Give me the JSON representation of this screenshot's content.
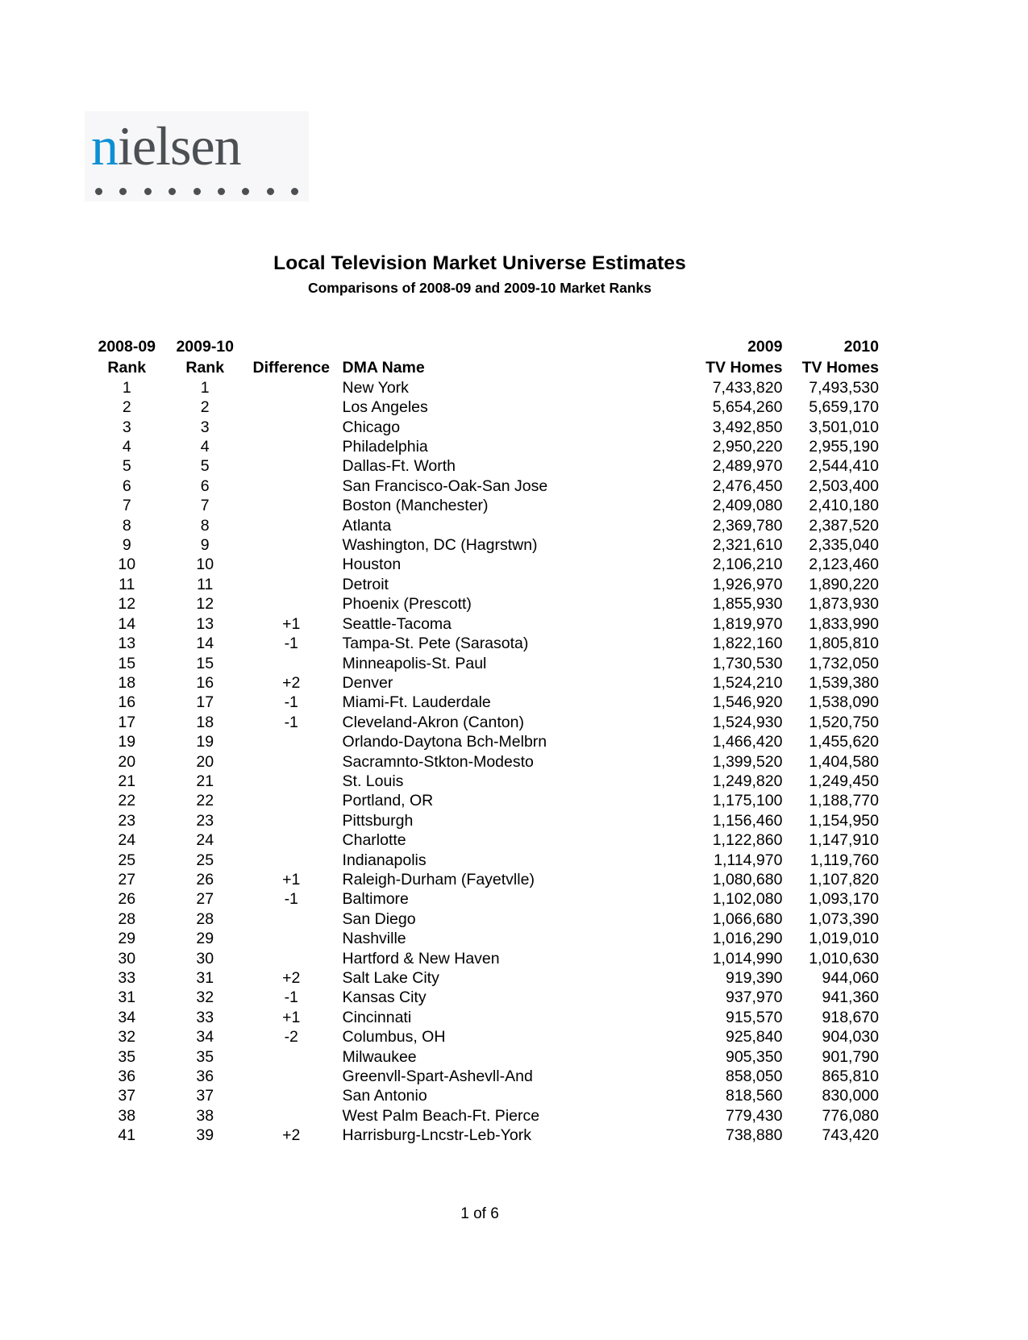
{
  "logo": {
    "first_letter": "n",
    "rest": "ielsen",
    "accent_color": "#0d8fd4",
    "text_color": "#4c4f53",
    "dot_count": 9
  },
  "document": {
    "title": "Local Television Market Universe Estimates",
    "subtitle": "Comparisons of 2008-09 and 2009-10 Market Ranks",
    "footer": "1 of 6"
  },
  "table": {
    "headers_top": {
      "rank_2008_09": "2008-09",
      "rank_2009_10": "2009-10",
      "difference": "",
      "dma_name": "",
      "tv_homes_2009": "2009",
      "tv_homes_2010": "2010"
    },
    "headers_bottom": {
      "rank_2008_09": "Rank",
      "rank_2009_10": "Rank",
      "difference": "Difference",
      "dma_name": "DMA Name",
      "tv_homes_2009": "TV Homes",
      "tv_homes_2010": "TV Homes"
    },
    "rows": [
      {
        "rank_2008_09": "1",
        "rank_2009_10": "1",
        "difference": "",
        "dma_name": "New York",
        "tv_homes_2009": "7,433,820",
        "tv_homes_2010": "7,493,530"
      },
      {
        "rank_2008_09": "2",
        "rank_2009_10": "2",
        "difference": "",
        "dma_name": "Los Angeles",
        "tv_homes_2009": "5,654,260",
        "tv_homes_2010": "5,659,170"
      },
      {
        "rank_2008_09": "3",
        "rank_2009_10": "3",
        "difference": "",
        "dma_name": "Chicago",
        "tv_homes_2009": "3,492,850",
        "tv_homes_2010": "3,501,010"
      },
      {
        "rank_2008_09": "4",
        "rank_2009_10": "4",
        "difference": "",
        "dma_name": "Philadelphia",
        "tv_homes_2009": "2,950,220",
        "tv_homes_2010": "2,955,190"
      },
      {
        "rank_2008_09": "5",
        "rank_2009_10": "5",
        "difference": "",
        "dma_name": "Dallas-Ft. Worth",
        "tv_homes_2009": "2,489,970",
        "tv_homes_2010": "2,544,410"
      },
      {
        "rank_2008_09": "6",
        "rank_2009_10": "6",
        "difference": "",
        "dma_name": "San Francisco-Oak-San Jose",
        "tv_homes_2009": "2,476,450",
        "tv_homes_2010": "2,503,400"
      },
      {
        "rank_2008_09": "7",
        "rank_2009_10": "7",
        "difference": "",
        "dma_name": "Boston (Manchester)",
        "tv_homes_2009": "2,409,080",
        "tv_homes_2010": "2,410,180"
      },
      {
        "rank_2008_09": "8",
        "rank_2009_10": "8",
        "difference": "",
        "dma_name": "Atlanta",
        "tv_homes_2009": "2,369,780",
        "tv_homes_2010": "2,387,520"
      },
      {
        "rank_2008_09": "9",
        "rank_2009_10": "9",
        "difference": "",
        "dma_name": "Washington, DC (Hagrstwn)",
        "tv_homes_2009": "2,321,610",
        "tv_homes_2010": "2,335,040"
      },
      {
        "rank_2008_09": "10",
        "rank_2009_10": "10",
        "difference": "",
        "dma_name": "Houston",
        "tv_homes_2009": "2,106,210",
        "tv_homes_2010": "2,123,460"
      },
      {
        "rank_2008_09": "11",
        "rank_2009_10": "11",
        "difference": "",
        "dma_name": "Detroit",
        "tv_homes_2009": "1,926,970",
        "tv_homes_2010": "1,890,220"
      },
      {
        "rank_2008_09": "12",
        "rank_2009_10": "12",
        "difference": "",
        "dma_name": "Phoenix (Prescott)",
        "tv_homes_2009": "1,855,930",
        "tv_homes_2010": "1,873,930"
      },
      {
        "rank_2008_09": "14",
        "rank_2009_10": "13",
        "difference": "+1",
        "dma_name": "Seattle-Tacoma",
        "tv_homes_2009": "1,819,970",
        "tv_homes_2010": "1,833,990"
      },
      {
        "rank_2008_09": "13",
        "rank_2009_10": "14",
        "difference": "-1",
        "dma_name": "Tampa-St. Pete (Sarasota)",
        "tv_homes_2009": "1,822,160",
        "tv_homes_2010": "1,805,810"
      },
      {
        "rank_2008_09": "15",
        "rank_2009_10": "15",
        "difference": "",
        "dma_name": "Minneapolis-St. Paul",
        "tv_homes_2009": "1,730,530",
        "tv_homes_2010": "1,732,050"
      },
      {
        "rank_2008_09": "18",
        "rank_2009_10": "16",
        "difference": "+2",
        "dma_name": "Denver",
        "tv_homes_2009": "1,524,210",
        "tv_homes_2010": "1,539,380"
      },
      {
        "rank_2008_09": "16",
        "rank_2009_10": "17",
        "difference": "-1",
        "dma_name": "Miami-Ft. Lauderdale",
        "tv_homes_2009": "1,546,920",
        "tv_homes_2010": "1,538,090"
      },
      {
        "rank_2008_09": "17",
        "rank_2009_10": "18",
        "difference": "-1",
        "dma_name": "Cleveland-Akron (Canton)",
        "tv_homes_2009": "1,524,930",
        "tv_homes_2010": "1,520,750"
      },
      {
        "rank_2008_09": "19",
        "rank_2009_10": "19",
        "difference": "",
        "dma_name": "Orlando-Daytona Bch-Melbrn",
        "tv_homes_2009": "1,466,420",
        "tv_homes_2010": "1,455,620"
      },
      {
        "rank_2008_09": "20",
        "rank_2009_10": "20",
        "difference": "",
        "dma_name": "Sacramnto-Stkton-Modesto",
        "tv_homes_2009": "1,399,520",
        "tv_homes_2010": "1,404,580"
      },
      {
        "rank_2008_09": "21",
        "rank_2009_10": "21",
        "difference": "",
        "dma_name": "St. Louis",
        "tv_homes_2009": "1,249,820",
        "tv_homes_2010": "1,249,450"
      },
      {
        "rank_2008_09": "22",
        "rank_2009_10": "22",
        "difference": "",
        "dma_name": "Portland, OR",
        "tv_homes_2009": "1,175,100",
        "tv_homes_2010": "1,188,770"
      },
      {
        "rank_2008_09": "23",
        "rank_2009_10": "23",
        "difference": "",
        "dma_name": "Pittsburgh",
        "tv_homes_2009": "1,156,460",
        "tv_homes_2010": "1,154,950"
      },
      {
        "rank_2008_09": "24",
        "rank_2009_10": "24",
        "difference": "",
        "dma_name": "Charlotte",
        "tv_homes_2009": "1,122,860",
        "tv_homes_2010": "1,147,910"
      },
      {
        "rank_2008_09": "25",
        "rank_2009_10": "25",
        "difference": "",
        "dma_name": "Indianapolis",
        "tv_homes_2009": "1,114,970",
        "tv_homes_2010": "1,119,760"
      },
      {
        "rank_2008_09": "27",
        "rank_2009_10": "26",
        "difference": "+1",
        "dma_name": "Raleigh-Durham (Fayetvlle)",
        "tv_homes_2009": "1,080,680",
        "tv_homes_2010": "1,107,820"
      },
      {
        "rank_2008_09": "26",
        "rank_2009_10": "27",
        "difference": "-1",
        "dma_name": "Baltimore",
        "tv_homes_2009": "1,102,080",
        "tv_homes_2010": "1,093,170"
      },
      {
        "rank_2008_09": "28",
        "rank_2009_10": "28",
        "difference": "",
        "dma_name": "San Diego",
        "tv_homes_2009": "1,066,680",
        "tv_homes_2010": "1,073,390"
      },
      {
        "rank_2008_09": "29",
        "rank_2009_10": "29",
        "difference": "",
        "dma_name": "Nashville",
        "tv_homes_2009": "1,016,290",
        "tv_homes_2010": "1,019,010"
      },
      {
        "rank_2008_09": "30",
        "rank_2009_10": "30",
        "difference": "",
        "dma_name": "Hartford & New Haven",
        "tv_homes_2009": "1,014,990",
        "tv_homes_2010": "1,010,630"
      },
      {
        "rank_2008_09": "33",
        "rank_2009_10": "31",
        "difference": "+2",
        "dma_name": "Salt Lake City",
        "tv_homes_2009": "919,390",
        "tv_homes_2010": "944,060"
      },
      {
        "rank_2008_09": "31",
        "rank_2009_10": "32",
        "difference": "-1",
        "dma_name": "Kansas City",
        "tv_homes_2009": "937,970",
        "tv_homes_2010": "941,360"
      },
      {
        "rank_2008_09": "34",
        "rank_2009_10": "33",
        "difference": "+1",
        "dma_name": "Cincinnati",
        "tv_homes_2009": "915,570",
        "tv_homes_2010": "918,670"
      },
      {
        "rank_2008_09": "32",
        "rank_2009_10": "34",
        "difference": "-2",
        "dma_name": "Columbus, OH",
        "tv_homes_2009": "925,840",
        "tv_homes_2010": "904,030"
      },
      {
        "rank_2008_09": "35",
        "rank_2009_10": "35",
        "difference": "",
        "dma_name": "Milwaukee",
        "tv_homes_2009": "905,350",
        "tv_homes_2010": "901,790"
      },
      {
        "rank_2008_09": "36",
        "rank_2009_10": "36",
        "difference": "",
        "dma_name": "Greenvll-Spart-Ashevll-And",
        "tv_homes_2009": "858,050",
        "tv_homes_2010": "865,810"
      },
      {
        "rank_2008_09": "37",
        "rank_2009_10": "37",
        "difference": "",
        "dma_name": "San Antonio",
        "tv_homes_2009": "818,560",
        "tv_homes_2010": "830,000"
      },
      {
        "rank_2008_09": "38",
        "rank_2009_10": "38",
        "difference": "",
        "dma_name": "West Palm Beach-Ft. Pierce",
        "tv_homes_2009": "779,430",
        "tv_homes_2010": "776,080"
      },
      {
        "rank_2008_09": "41",
        "rank_2009_10": "39",
        "difference": "+2",
        "dma_name": "Harrisburg-Lncstr-Leb-York",
        "tv_homes_2009": "738,880",
        "tv_homes_2010": "743,420"
      }
    ]
  }
}
